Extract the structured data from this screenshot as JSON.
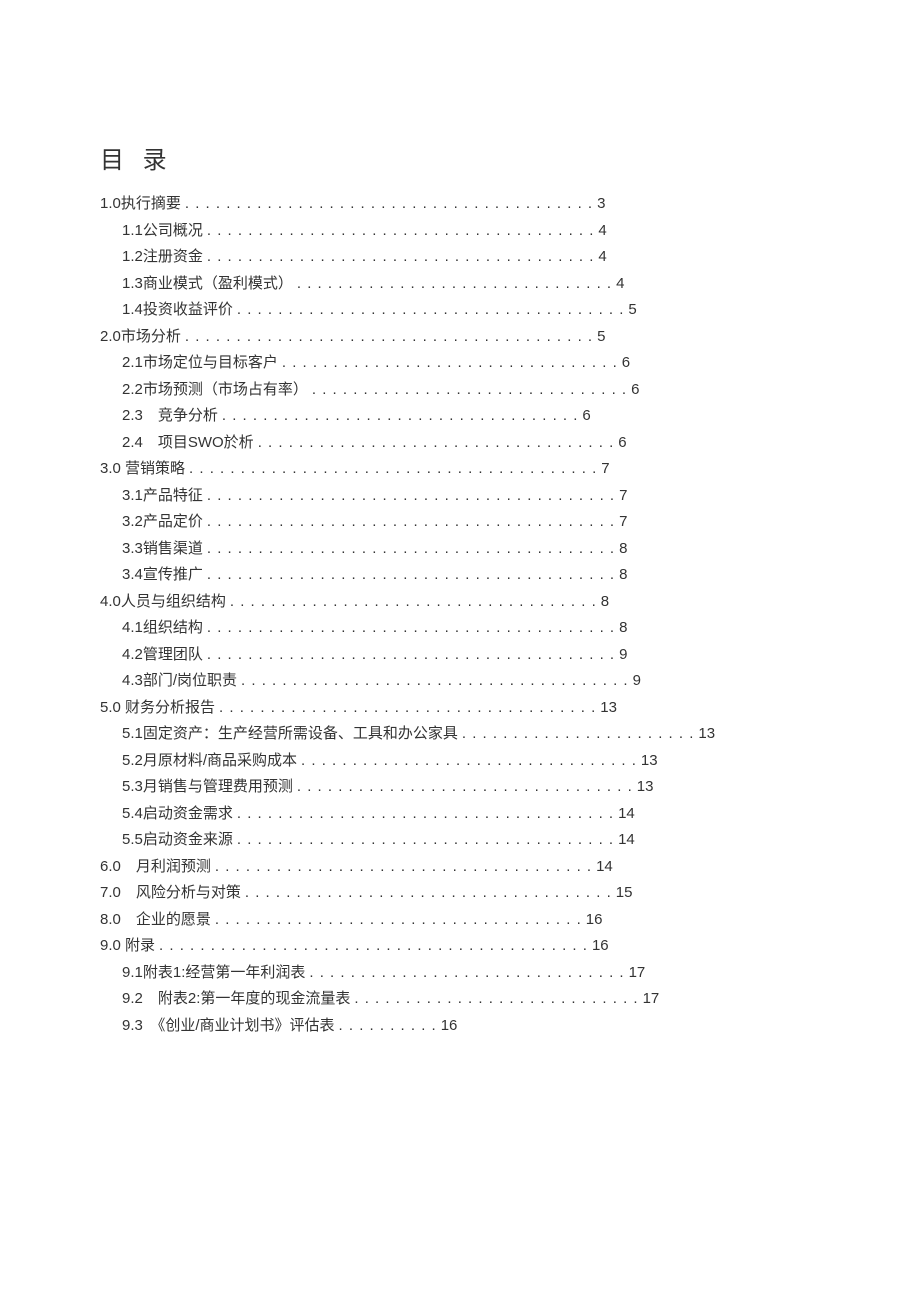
{
  "title": "目 录",
  "entries": [
    {
      "level": 0,
      "label": "1.0执行摘要",
      "page": "3",
      "leader": 40
    },
    {
      "level": 1,
      "label": "1.1公司概况",
      "page": "4",
      "leader": 38
    },
    {
      "level": 1,
      "label": "1.2注册资金",
      "page": "4",
      "leader": 38
    },
    {
      "level": 1,
      "label": "1.3商业模式（盈利模式）",
      "page": "4",
      "leader": 31
    },
    {
      "level": 1,
      "label": "1.4投资收益评价",
      "page": "5",
      "leader": 38
    },
    {
      "level": 0,
      "label": "2.0市场分析",
      "page": "5",
      "leader": 40
    },
    {
      "level": 1,
      "label": "2.1市场定位与目标客户",
      "page": "6",
      "leader": 33
    },
    {
      "level": 1,
      "label": "2.2市场预测（市场占有率）",
      "page": "6",
      "leader": 31
    },
    {
      "level": 1,
      "label": "2.3　竞争分析",
      "page": "6",
      "leader": 35
    },
    {
      "level": 1,
      "label": "2.4　项目SWO於析",
      "page": "6",
      "leader": 35
    },
    {
      "level": 0,
      "label": "3.0 营销策略",
      "page": "7",
      "leader": 40
    },
    {
      "level": 1,
      "label": "3.1产品特征",
      "page": "7",
      "leader": 40
    },
    {
      "level": 1,
      "label": "3.2产品定价",
      "page": "7",
      "leader": 40
    },
    {
      "level": 1,
      "label": "3.3销售渠道",
      "page": "8",
      "leader": 40
    },
    {
      "level": 1,
      "label": "3.4宣传推广",
      "page": "8",
      "leader": 40
    },
    {
      "level": 0,
      "label": "4.0人员与组织结构",
      "page": "8",
      "leader": 36
    },
    {
      "level": 1,
      "label": "4.1组织结构",
      "page": "8",
      "leader": 40
    },
    {
      "level": 1,
      "label": "4.2管理团队",
      "page": "9",
      "leader": 40
    },
    {
      "level": 1,
      "label": "4.3部门/岗位职责",
      "page": "9",
      "leader": 38
    },
    {
      "level": 0,
      "label": "5.0 财务分析报告",
      "page": "13",
      "leader": 37
    },
    {
      "level": 1,
      "label": "5.1固定资产：生产经营所需设备、工具和办公家具",
      "page": "13",
      "leader": 23
    },
    {
      "level": 1,
      "label": "5.2月原材料/商品采购成本",
      "page": "13",
      "leader": 33
    },
    {
      "level": 1,
      "label": "5.3月销售与管理费用预测",
      "page": "13",
      "leader": 33
    },
    {
      "level": 1,
      "label": "5.4启动资金需求",
      "page": "14",
      "leader": 37
    },
    {
      "level": 1,
      "label": "5.5启动资金来源",
      "page": "14",
      "leader": 37
    },
    {
      "level": 0,
      "label": "6.0　月利润预测",
      "page": "14",
      "leader": 37
    },
    {
      "level": 0,
      "label": "7.0　风险分析与对策",
      "page": "15",
      "leader": 36
    },
    {
      "level": 0,
      "label": "8.0　企业的愿景",
      "page": "16",
      "leader": 36
    },
    {
      "level": 0,
      "label": "9.0 附录",
      "page": "16",
      "leader": 42
    },
    {
      "level": 1,
      "label": "9.1附表1:经营第一年利润表",
      "page": "17",
      "leader": 31
    },
    {
      "level": 1,
      "label": "9.2　附表2:第一年度的现金流量表",
      "page": "17",
      "leader": 28
    },
    {
      "level": 1,
      "label": "9.3　《创业/商业计划书》评估表",
      "page": "16",
      "leader": 10
    }
  ]
}
